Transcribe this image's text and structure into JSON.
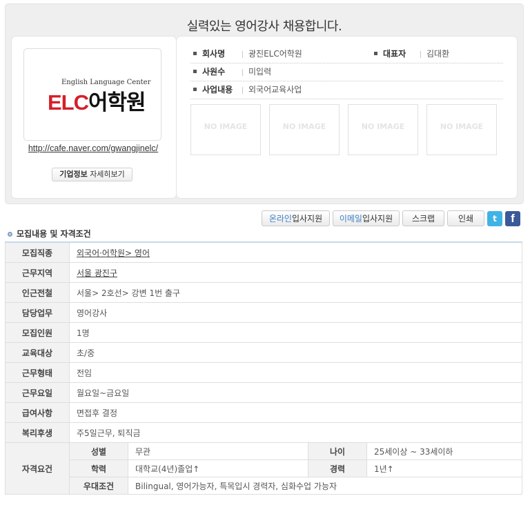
{
  "header": {
    "title": "실력있는 영어강사 채용합니다."
  },
  "company_logo": {
    "tagline": "English Language Center",
    "brand_latin": "ELC",
    "brand_korean": "어학원"
  },
  "company": {
    "url": "http://cafe.naver.com/gwangjinelc/",
    "info_button_bold": "기업정보",
    "info_button_text": "자세히보기",
    "name_label": "회사명",
    "name_value": "광진ELC어학원",
    "ceo_label": "대표자",
    "ceo_value": "김대환",
    "employees_label": "사원수",
    "employees_value": "미입력",
    "business_label": "사업내용",
    "business_value": "외국어교육사업",
    "no_image_text": "NO IMAGE"
  },
  "actions": {
    "online_apply_hl": "온라인",
    "online_apply": "입사지원",
    "email_apply_hl": "이메일",
    "email_apply": "입사지원",
    "scrap": "스크랩",
    "print": "인쇄",
    "twitter_icon": "twitter-icon",
    "facebook_icon": "facebook-icon"
  },
  "section": {
    "title": "모집내용 및 자격조건"
  },
  "spec": {
    "job_type": {
      "label": "모집직종",
      "value": "외국어·어학원> 영어"
    },
    "location": {
      "label": "근무지역",
      "value": "서울 광진구"
    },
    "nearby_station": {
      "label": "인근전철",
      "value": "서울> 2호선> 강변 1번 출구"
    },
    "duties": {
      "label": "담당업무",
      "value": "영어강사"
    },
    "headcount": {
      "label": "모집인원",
      "value": "1명"
    },
    "target": {
      "label": "교육대상",
      "value": "초/중"
    },
    "employment_type": {
      "label": "근무형태",
      "value": "전임"
    },
    "work_days": {
      "label": "근무요일",
      "value": "월요일~금요일"
    },
    "salary": {
      "label": "급여사항",
      "value": "면접후 결정"
    },
    "benefits": {
      "label": "복리후생",
      "value": "주5일근무, 퇴직금"
    },
    "qualifications": {
      "label": "자격요건",
      "gender_label": "성별",
      "gender_value": "무관",
      "age_label": "나이",
      "age_value": "25세이상 ~ 33세이하",
      "education_label": "학력",
      "education_value": "대학교(4년)졸업↑",
      "career_label": "경력",
      "career_value": "1년↑",
      "preference_label": "우대조건",
      "preference_value": "Bilingual, 영어가능자, 특목입시 경력자, 심화수업 가능자"
    }
  }
}
